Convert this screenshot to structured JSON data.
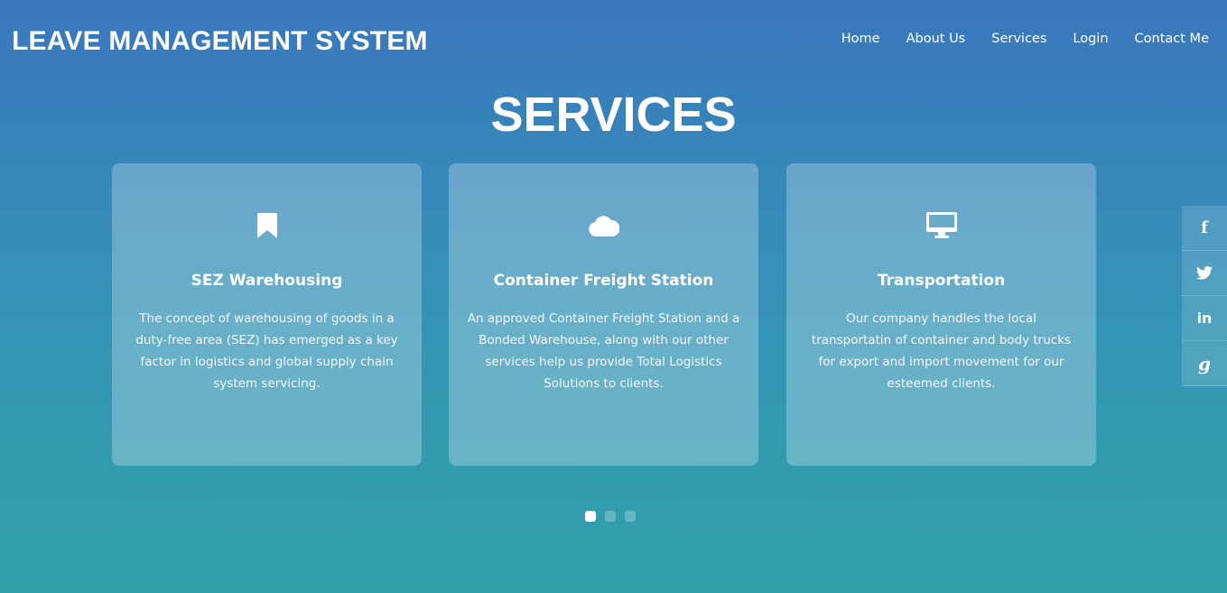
{
  "header": {
    "brand": "LEAVE MANAGEMENT SYSTEM",
    "nav": [
      {
        "label": "Home"
      },
      {
        "label": "About Us"
      },
      {
        "label": "Services"
      },
      {
        "label": "Login"
      },
      {
        "label": "Contact Me"
      }
    ]
  },
  "main": {
    "title": "SERVICES",
    "cards": [
      {
        "icon": "bookmark-icon",
        "title": "SEZ Warehousing",
        "text": "The concept of warehousing of goods in a duty-free area (SEZ) has emerged as a key factor in logistics and global supply chain system servicing."
      },
      {
        "icon": "cloud-icon",
        "title": "Container Freight Station",
        "text": "An approved Container Freight Station and a Bonded Warehouse, along with our other services help us provide Total Logistics Solutions to clients."
      },
      {
        "icon": "desktop-icon",
        "title": "Transportation",
        "text": "Our company handles the local transportatin of container and body trucks for export and import movement for our esteemed clients."
      }
    ],
    "carousel": {
      "active_index": 0,
      "dot_count": 3
    }
  },
  "social": [
    {
      "icon": "facebook-icon",
      "glyph": "f"
    },
    {
      "icon": "twitter-icon",
      "glyph": "t"
    },
    {
      "icon": "linkedin-icon",
      "glyph": "in"
    },
    {
      "icon": "google-icon",
      "glyph": "g"
    }
  ],
  "colors": {
    "gradient_top": "#3a77bd",
    "gradient_bottom": "#31a2aa",
    "text": "#ffffff"
  }
}
